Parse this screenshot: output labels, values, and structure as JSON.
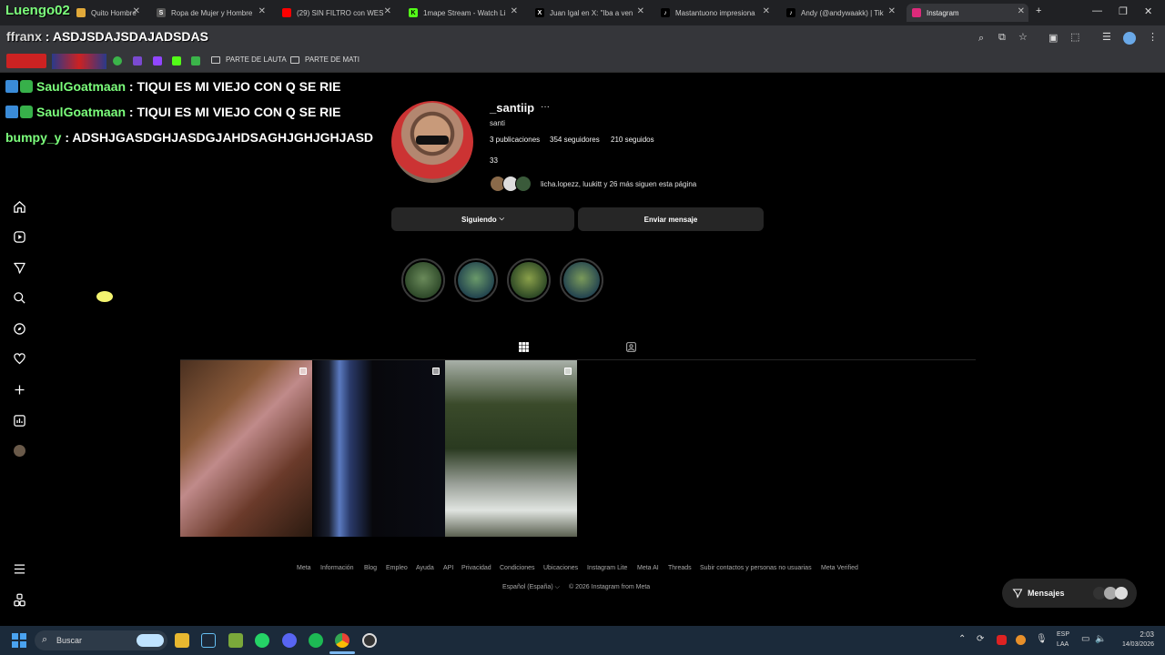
{
  "browser": {
    "tabs": [
      {
        "title": "Quito Hombre",
        "favicon_color": "#e1a93a"
      },
      {
        "title": "Ropa de Mujer y Hombre",
        "favicon_color": "#555555"
      },
      {
        "title": "(29) SIN FILTRO con WES",
        "favicon_color": "#ff0000"
      },
      {
        "title": "1mape Stream - Watch Li",
        "favicon_color": "#53fc18"
      },
      {
        "title": "Juan Igal en X: \"Iba a ven",
        "favicon_color": "#000000"
      },
      {
        "title": "Mastantuono impresiona",
        "favicon_color": "#000000"
      },
      {
        "title": "Andy (@andywaakk) | Tik",
        "favicon_color": "#000000"
      },
      {
        "title": "Instagram",
        "favicon_color": "#dd2a7b"
      }
    ],
    "new_tab": "+",
    "bookmarks": [
      {
        "label": "PARTE DE LAUTA"
      },
      {
        "label": "PARTE DE MATI"
      }
    ]
  },
  "overlay": {
    "top_name": "Luengo02",
    "ffranx_line": {
      "user": "ffranx",
      "message": "ASDJSDAJSDAJADSDAS"
    },
    "chat": [
      {
        "user": "SaulGoatmaan",
        "message": ": TIQUI ES MI VIEJO CON Q SE RIE"
      },
      {
        "user": "SaulGoatmaan",
        "message": ": TIQUI ES MI VIEJO CON Q SE RIE"
      },
      {
        "user": "bumpy_y",
        "message": ": ADSHJGASDGHJASDGJAHDSAGHJGHJGHJASD"
      }
    ]
  },
  "profile": {
    "username": "_santiip",
    "more": "···",
    "full_name": "santi",
    "posts": "3 publicaciones",
    "followers": "354 seguidores",
    "following": "210 seguidos",
    "bio": "33",
    "followed_by": "licha.lopezz, luukitt y 26 más siguen esta página",
    "following_button": "Siguiendo",
    "message_button": "Enviar mensaje"
  },
  "highlights_colors": [
    "#3f5a3a",
    "#2c4c55",
    "#3d5a2f",
    "#2e4e5a"
  ],
  "footer": {
    "links": [
      "Meta",
      "Información",
      "Blog",
      "Empleo",
      "Ayuda",
      "API",
      "Privacidad",
      "Condiciones",
      "Ubicaciones",
      "Instagram Lite",
      "Meta AI",
      "Threads",
      "Subir contactos y personas no usuarias",
      "Meta Verified"
    ],
    "language": "Español (España)",
    "copyright": "© 2026 Instagram from Meta"
  },
  "messages_label": "Mensajes",
  "taskbar": {
    "search_placeholder": "Buscar",
    "lang": "ESP",
    "lang2": "LAA",
    "time": "2:03",
    "date": "14/03/2026"
  },
  "icons": [
    "home-icon",
    "reels-icon",
    "direct-icon",
    "search-icon",
    "explore-icon",
    "heart-icon",
    "create-icon",
    "dashboard-icon",
    "profile-icon",
    "menu-icon",
    "threads-icon",
    "grid-icon",
    "tagged-icon"
  ]
}
